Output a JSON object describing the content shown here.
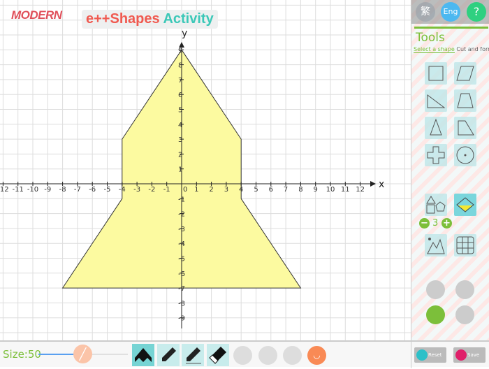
{
  "header": {
    "logo": "MODERN",
    "title_part1": "e++Shapes",
    "title_part2": "Activity"
  },
  "graph": {
    "x_label": "x",
    "y_label": "y",
    "x_range": [
      -12,
      12
    ],
    "y_range": [
      -9,
      9
    ],
    "polygon": [
      [
        0,
        9
      ],
      [
        4,
        3
      ],
      [
        4,
        -1
      ],
      [
        8,
        -7
      ],
      [
        -8,
        -7
      ],
      [
        -4,
        -1
      ],
      [
        -4,
        3
      ]
    ],
    "fill_color": "#fcfaa0"
  },
  "panel": {
    "lang_trad": "繁",
    "lang_eng": "Eng",
    "help": "?",
    "title": "Tools",
    "tab_select": "Select a shape",
    "tab_cut": "Cut and form",
    "count": "3",
    "minus": "−",
    "plus": "+"
  },
  "bottom": {
    "size_label": "Size:50",
    "size_value": 50,
    "reset": "Reset",
    "save": "Save"
  },
  "colors": {
    "green": "#7cbf3a",
    "teal": "#76d4d4",
    "orange": "#f98a55"
  }
}
